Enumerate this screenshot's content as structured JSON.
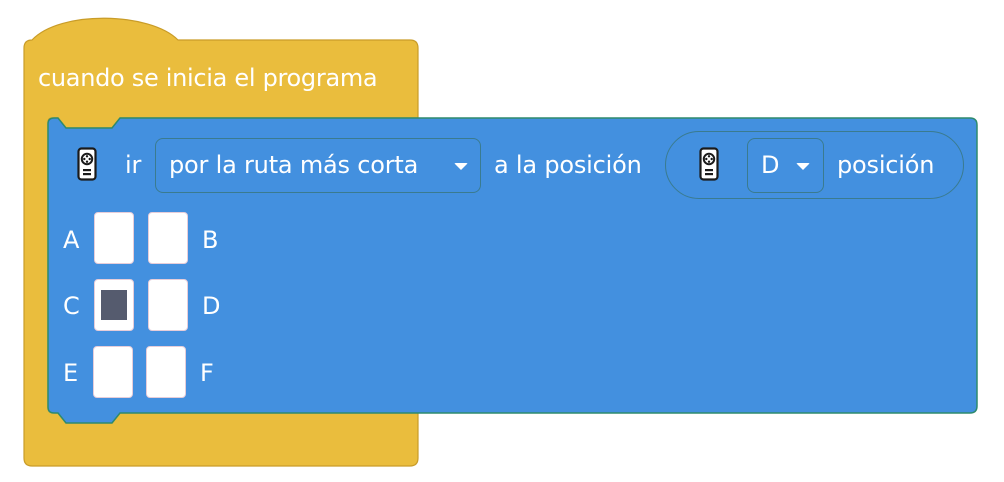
{
  "hat_block": {
    "label": "cuando se inicia el programa",
    "color": "#eabd3d"
  },
  "move_block": {
    "color": "#4390df",
    "icon": "remote-control-icon",
    "verb": "ir",
    "route_dropdown": {
      "selected": "por la ruta más corta"
    },
    "target_label": "a la posición",
    "position_reporter": {
      "icon": "remote-control-icon",
      "dropdown": {
        "selected": "D"
      },
      "label": "posición"
    },
    "grid": {
      "cells": [
        {
          "label": "A",
          "selected": false
        },
        {
          "label": "B",
          "selected": false
        },
        {
          "label": "C",
          "selected": true
        },
        {
          "label": "D",
          "selected": false
        },
        {
          "label": "E",
          "selected": false
        },
        {
          "label": "F",
          "selected": false
        }
      ]
    }
  }
}
